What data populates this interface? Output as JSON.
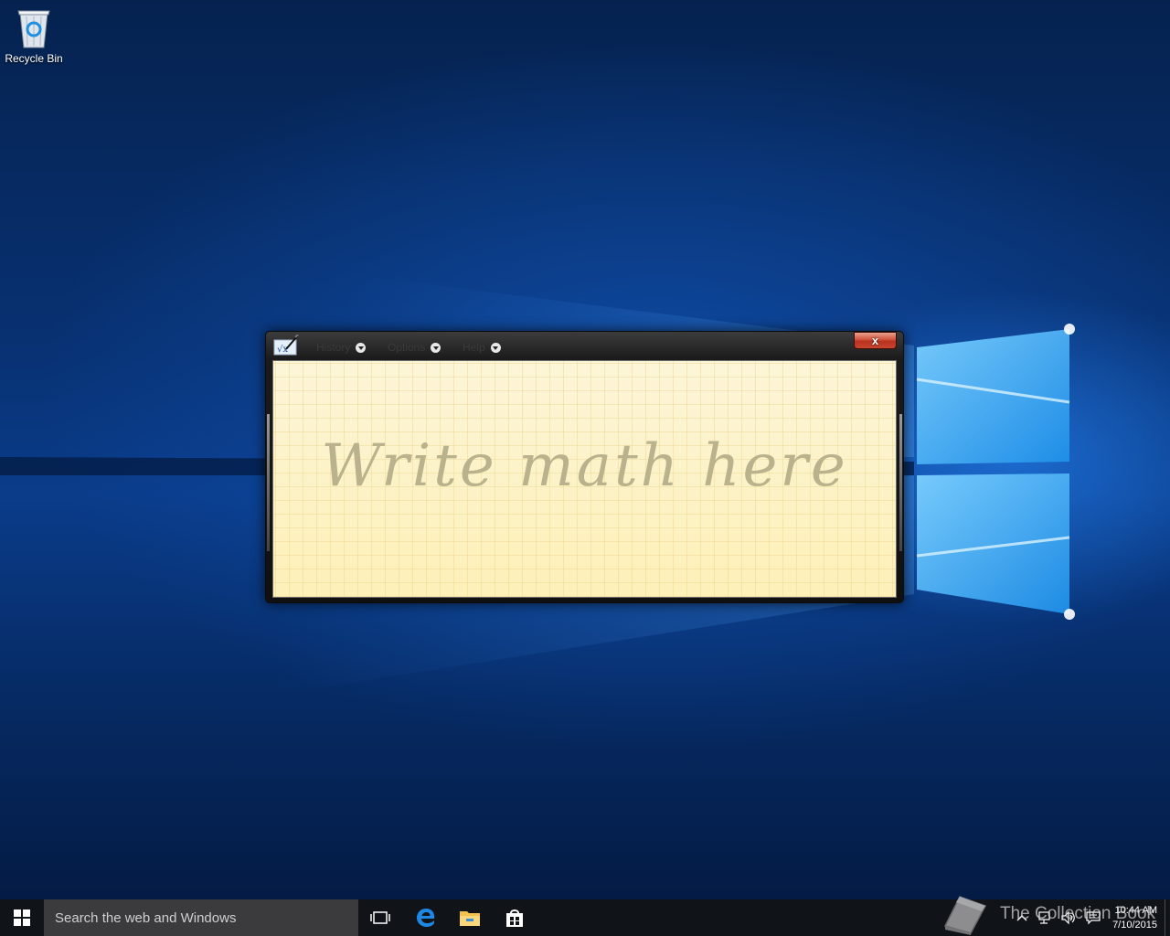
{
  "desktop": {
    "icons": [
      {
        "label": "Recycle Bin",
        "icon": "recycle-bin-icon"
      }
    ]
  },
  "window": {
    "app_icon": "math-input-panel-icon",
    "menus": [
      {
        "label": "History"
      },
      {
        "label": "Options"
      },
      {
        "label": "Help"
      }
    ],
    "close_label": "x",
    "canvas_hint": "Write math here"
  },
  "taskbar": {
    "search_placeholder": "Search the web and Windows",
    "pinned": [
      "task-view-icon",
      "edge-icon",
      "file-explorer-icon",
      "store-icon"
    ],
    "tray_icons": [
      "chevron-up-icon",
      "network-icon",
      "volume-icon",
      "action-center-icon"
    ],
    "time": "10:44 AM",
    "date": "7/10/2015"
  },
  "watermark": {
    "text": "The Collection Book"
  },
  "colors": {
    "window_frame": "#1b1b1b",
    "canvas": "#fdf3c4",
    "close_button": "#c8452f",
    "taskbar": "#101318",
    "search_box": "#3b3b3d"
  }
}
